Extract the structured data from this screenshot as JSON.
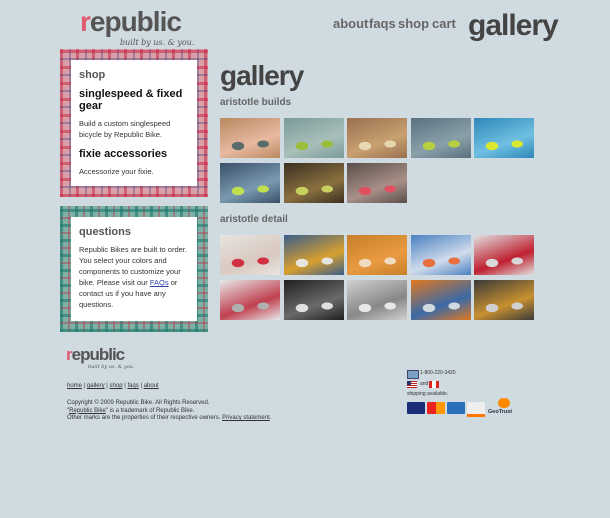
{
  "brand": {
    "logo_text": "republic",
    "tagline": "built by us. & you."
  },
  "nav": {
    "items": [
      "about",
      "faqs",
      "shop",
      "cart"
    ],
    "page_title": "gallery"
  },
  "sidebar": {
    "shop": {
      "heading": "shop",
      "item1_title": "singlespeed & fixed gear",
      "item1_desc": "Build a custom singlespeed bicycle by Republic Bike.",
      "item2_title": "fixie accessories",
      "item2_desc": "Accessorize your fixie."
    },
    "questions": {
      "heading": "questions",
      "text_before": "Republic Bikes are built to order. You select your colors and components to customize your bike. Please visit our ",
      "link": "FAQs",
      "text_after": " or contact us if you have any questions."
    }
  },
  "main": {
    "title": "gallery",
    "section1": {
      "title": "aristotle builds",
      "thumbs": [
        {
          "label": "bike in shop",
          "colors": [
            "#b88a60",
            "#e8b8a0",
            "#5a6d6a"
          ]
        },
        {
          "label": "bike on wall",
          "colors": [
            "#7a9a9a",
            "#a9bfb9",
            "#9bbf3a"
          ]
        },
        {
          "label": "bikes by shelves",
          "colors": [
            "#9a7050",
            "#c8a070",
            "#e6d8b0"
          ]
        },
        {
          "label": "bike under bridge",
          "colors": [
            "#5a7080",
            "#8aa0a8",
            "#b8d040"
          ]
        },
        {
          "label": "bike at beach",
          "colors": [
            "#2f86b9",
            "#6fc0e0",
            "#d8e830"
          ]
        },
        {
          "label": "bike on dock",
          "colors": [
            "#3a5068",
            "#7a9ab0",
            "#c0e050"
          ]
        },
        {
          "label": "bike in garage",
          "colors": [
            "#3a3020",
            "#8a7040",
            "#c8d060"
          ]
        },
        {
          "label": "bike in street",
          "colors": [
            "#5a4e4a",
            "#a89088",
            "#e05060"
          ]
        }
      ]
    },
    "section2": {
      "title": "aristotle detail",
      "thumbs": [
        {
          "label": "red handlebar",
          "colors": [
            "#e8e4e0",
            "#d8c8c0",
            "#d03040"
          ]
        },
        {
          "label": "gold crank",
          "colors": [
            "#3a5e8a",
            "#d8a030",
            "#e8e4e0"
          ]
        },
        {
          "label": "orange chain",
          "colors": [
            "#c8802a",
            "#e89a40",
            "#f0dcc0"
          ]
        },
        {
          "label": "blue frame",
          "colors": [
            "#4a80c0",
            "#d0dcec",
            "#e87040"
          ]
        },
        {
          "label": "red chain",
          "colors": [
            "#e0e0e0",
            "#c02030",
            "#d8d8d8"
          ]
        },
        {
          "label": "brake lever",
          "colors": [
            "#e8e8e8",
            "#c04050",
            "#b0b0b0"
          ]
        },
        {
          "label": "saddle",
          "colors": [
            "#202020",
            "#6a6a6a",
            "#e0e0e0"
          ]
        },
        {
          "label": "frame joint",
          "colors": [
            "#d0d0d0",
            "#888888",
            "#e8e8e8"
          ]
        },
        {
          "label": "orange fork",
          "colors": [
            "#e07820",
            "#3a6aa8",
            "#d0d8e0"
          ]
        },
        {
          "label": "hub detail",
          "colors": [
            "#3a3a3a",
            "#c89030",
            "#d0d0d0"
          ]
        }
      ]
    }
  },
  "footer": {
    "links": [
      "home",
      "gallery",
      "shop",
      "faqs",
      "about"
    ],
    "separator": " | ",
    "copyright": "Copyright © 2009 Republic Bike. All Rights Reserved.",
    "trademark_quote_open": "\"",
    "trademark_link": "Republic Bike",
    "trademark_rest": "\" is a trademark of Republic Bike.",
    "other_marks": "Other marks are the properties of their respective owners. ",
    "privacy": "Privacy statement",
    "privacy_end": ".",
    "phone": "1-800-220-3420",
    "and": "and",
    "shipping": "shipping available.",
    "cards": [
      "VISA",
      "MC",
      "AMEX",
      "DISCOVER"
    ],
    "geotrust": "GeoTrust"
  }
}
